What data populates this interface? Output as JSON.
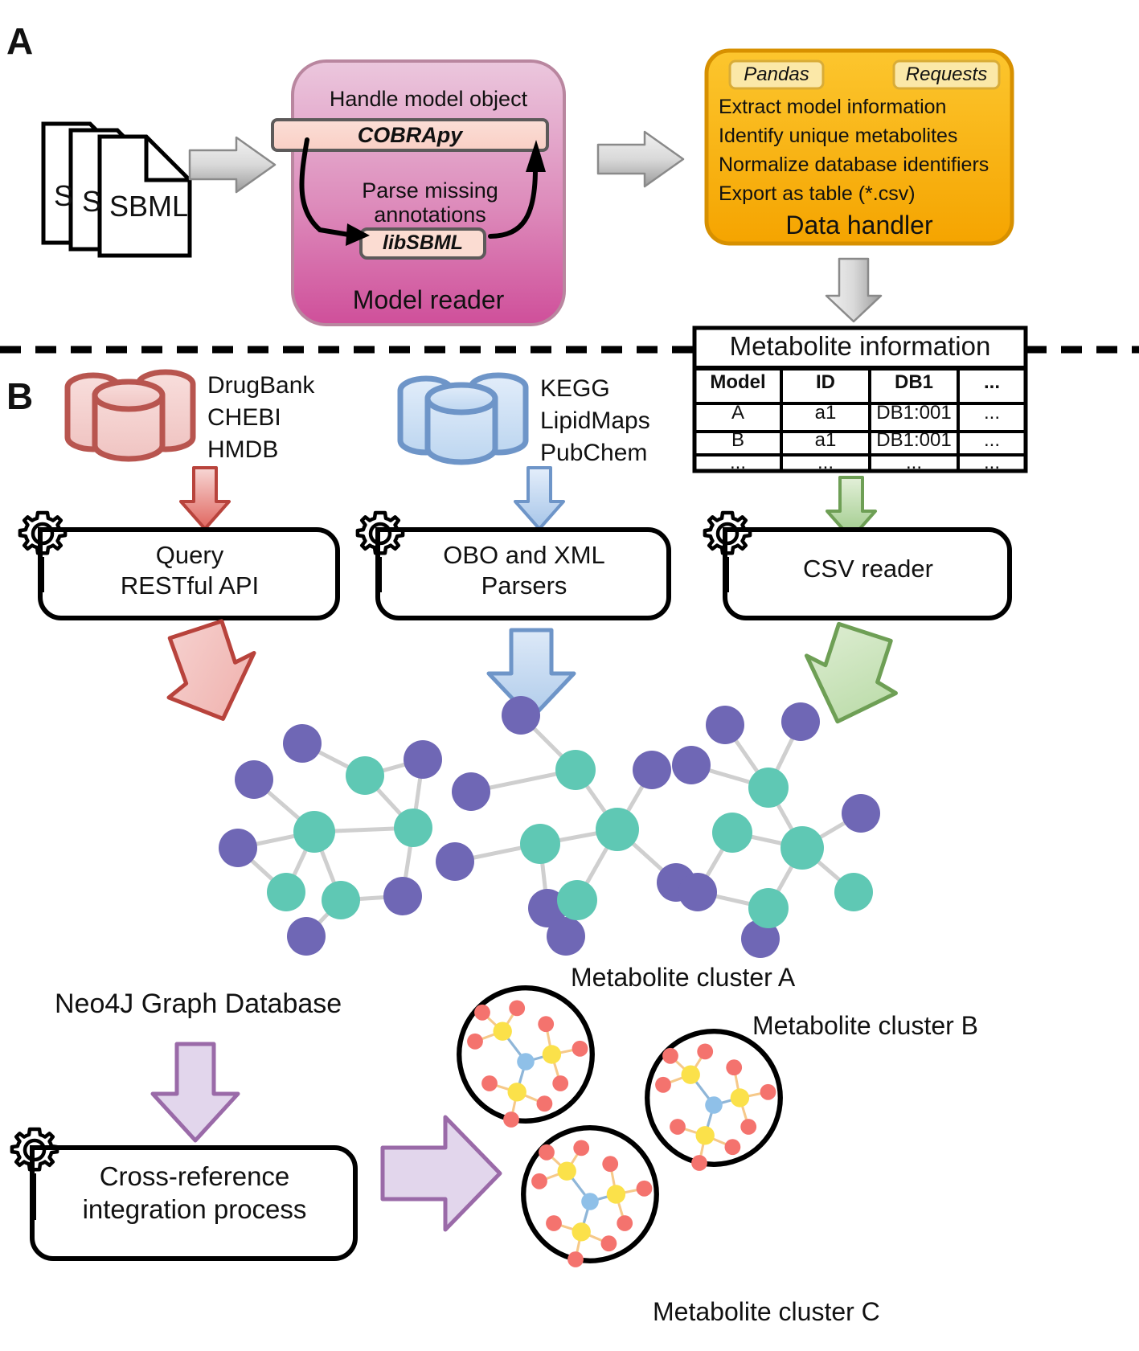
{
  "figure": {
    "panels": [
      {
        "id": "A",
        "label": "A"
      },
      {
        "id": "B",
        "label": "B"
      }
    ]
  },
  "panel_a": {
    "input_files": {
      "name": "sbml-document-stack",
      "sheets": [
        "S",
        "S",
        "SBML"
      ]
    },
    "model_reader": {
      "title": "Model reader",
      "step1_caption": "Handle model object",
      "step1_library": "COBRApy",
      "step2_caption_line1": "Parse missing",
      "step2_caption_line2": "annotations",
      "step2_library": "libSBML",
      "color_top": "#e9c3da",
      "color_bottom": "#d2579f"
    },
    "data_handler": {
      "title": "Data handler",
      "libraries": [
        "Pandas",
        "Requests"
      ],
      "bullets": [
        "Extract model information",
        "Identify unique metabolites",
        "Normalize database identifiers",
        "Export as table (*.csv)"
      ],
      "color": "#f7a800"
    },
    "arrows": [
      {
        "name": "arrow-files-to-model-reader",
        "direction": "right",
        "color": "#c8c8c8"
      },
      {
        "name": "arrow-model-reader-to-data-handler",
        "direction": "right",
        "color": "#c8c8c8"
      },
      {
        "name": "arrow-data-handler-to-table",
        "direction": "down",
        "color": "#c8c8c8"
      }
    ]
  },
  "metabolite_table": {
    "title": "Metabolite information",
    "columns": [
      "Model",
      "ID",
      "DB1",
      "..."
    ],
    "rows": [
      [
        "A",
        "a1",
        "DB1:001",
        "..."
      ],
      [
        "B",
        "a1",
        "DB1:001",
        "..."
      ],
      [
        "...",
        "...",
        "...",
        "..."
      ]
    ]
  },
  "panel_b": {
    "sources": [
      {
        "name": "database-cylinder-red",
        "color_stroke": "#b8554f",
        "color_fill": "#f3cccb",
        "arrow_color": "#e07a74",
        "labels": [
          "DrugBank",
          "CHEBI",
          "HMDB"
        ],
        "process": {
          "line1": "Query",
          "line2": "RESTful API",
          "icon": "gear-icon"
        }
      },
      {
        "name": "database-cylinder-blue",
        "color_stroke": "#6e95c8",
        "color_fill": "#cfe0f3",
        "arrow_color": "#a8c6e8",
        "labels": [
          "KEGG",
          "LipidMaps",
          "PubChem"
        ],
        "process": {
          "line1": "OBO and XML",
          "line2": "Parsers",
          "icon": "gear-icon"
        }
      },
      {
        "name": "metabolite-information-source",
        "color_stroke": "#7fb36a",
        "color_fill": "#cde5bf",
        "arrow_color": "#a9d394",
        "labels": [],
        "process": {
          "line1": "CSV reader",
          "line2": "",
          "icon": "gear-icon"
        }
      }
    ],
    "graph": {
      "name": "neo4j-network-graph",
      "node_color_purple": "#6f67b5",
      "node_color_teal": "#5fc8b4",
      "edge_color": "#cccccc",
      "caption": "Neo4J Graph Database"
    },
    "integration": {
      "arrow_color_fill": "#e0d4ea",
      "arrow_color_stroke": "#9a6aa8",
      "process": {
        "line1": "Cross-reference",
        "line2": "integration process",
        "icon": "gear-icon"
      }
    },
    "clusters": [
      {
        "name": "metabolite-cluster-a",
        "label": "Metabolite cluster A"
      },
      {
        "name": "metabolite-cluster-b",
        "label": "Metabolite cluster B"
      },
      {
        "name": "metabolite-cluster-c",
        "label": "Metabolite cluster C"
      }
    ],
    "cluster_colors": {
      "hub": "#8fc0e8",
      "mid": "#fbe14a",
      "leaf": "#f4736e",
      "edge_outer": "#f6c98a",
      "edge_inner": "#8fb6d8",
      "circle_stroke": "#000000"
    }
  },
  "divider": {
    "name": "panel-divider-dashed",
    "color": "#000000"
  }
}
